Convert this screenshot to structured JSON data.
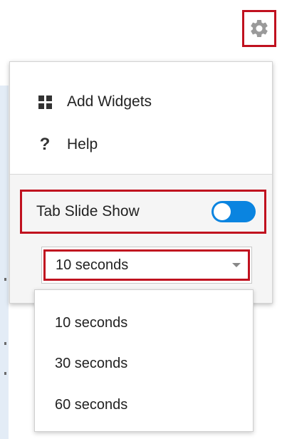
{
  "settings_button": {
    "icon": "gear-icon",
    "highlight_color": "#c0111f"
  },
  "menu": {
    "items": [
      {
        "label": "Add Widgets",
        "icon": "grid-icon"
      },
      {
        "label": "Help",
        "icon": "help-icon"
      }
    ],
    "slide_show": {
      "label": "Tab Slide Show",
      "enabled": true,
      "toggle_color": "#0a84e0"
    },
    "interval_select": {
      "selected": "10 seconds",
      "options": [
        "10 seconds",
        "30 seconds",
        "60 seconds"
      ]
    }
  }
}
